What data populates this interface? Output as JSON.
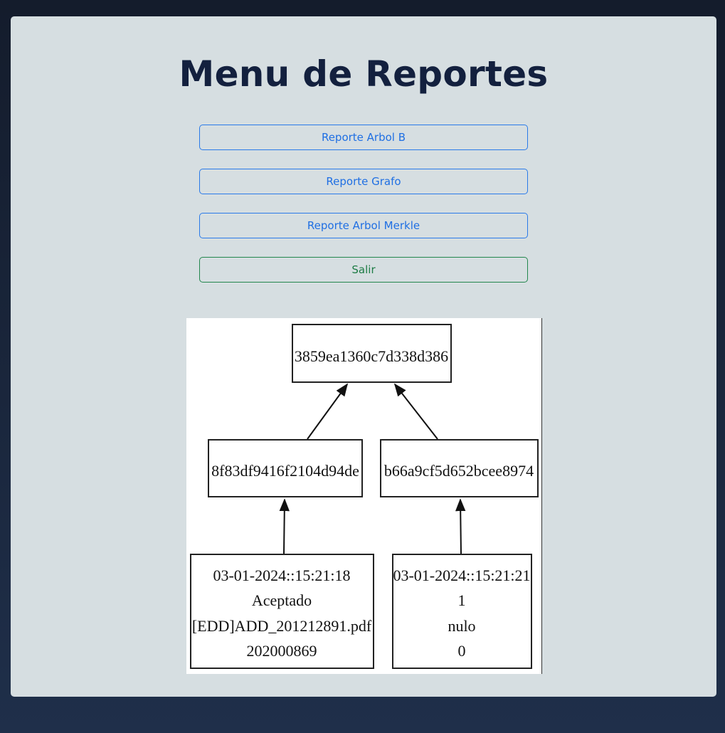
{
  "page": {
    "title": "Menu de Reportes"
  },
  "menu": {
    "btn_arbol_b": "Reporte Arbol B",
    "btn_grafo": "Reporte Grafo",
    "btn_merkle": "Reporte Arbol Merkle",
    "btn_salir": "Salir"
  },
  "colors": {
    "background": "#1a2538",
    "card": "#d6dee1",
    "title": "#13203e",
    "primary": "#1f6fe3",
    "success": "#1d7c45"
  },
  "merkle": {
    "root": "3859ea1360c7d338d386",
    "left_hash": "8f83df9416f2104d94de",
    "right_hash": "b66a9cf5d652bcee8974",
    "left_leaf": [
      "03-01-2024::15:21:18",
      "Aceptado",
      "[EDD]ADD_201212891.pdf",
      "202000869"
    ],
    "right_leaf": [
      "03-01-2024::15:21:21",
      "1",
      "nulo",
      "0"
    ]
  }
}
